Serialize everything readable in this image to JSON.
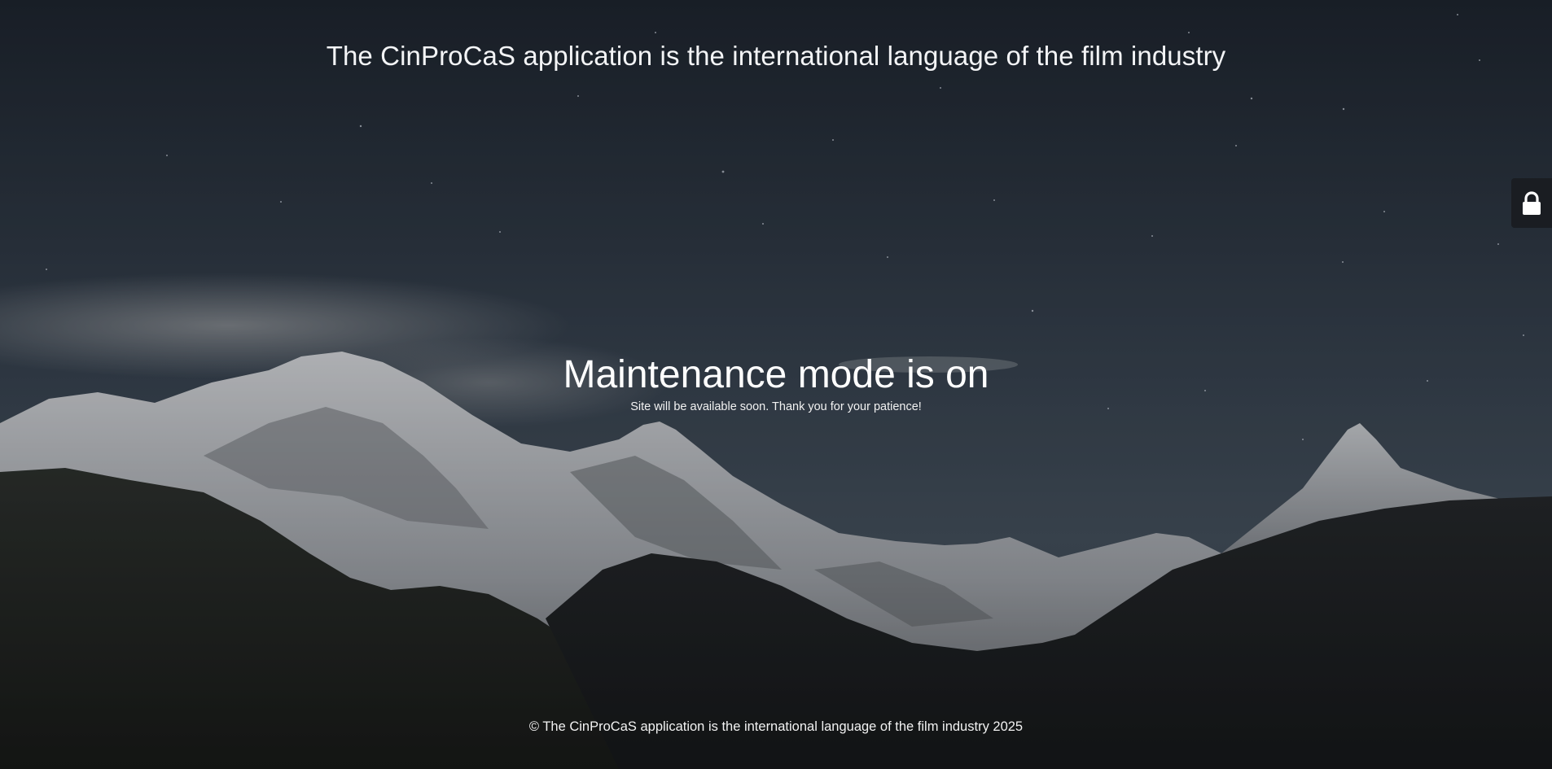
{
  "header": {
    "site_title": "The CinProCaS application is the international language of the film industry"
  },
  "main": {
    "headline": "Maintenance mode is on",
    "message": "Site will be available soon. Thank you for your patience!"
  },
  "footer": {
    "copyright": "© The CinProCaS application is the international language of the film industry 2025"
  },
  "login_tab": {
    "icon": "lock-icon"
  },
  "colors": {
    "sky_top": "#202833",
    "sky_mid": "#3a4654",
    "snow": "#c9ccd1",
    "foothills": "#1e211f",
    "tab_bg": "#1a1d22"
  }
}
